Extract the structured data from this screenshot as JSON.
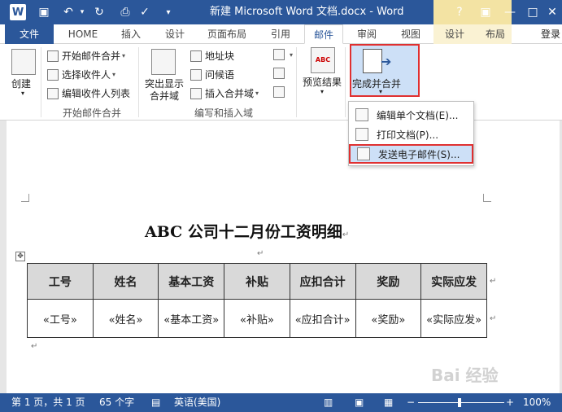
{
  "titlebar": {
    "app_logo": "W",
    "title": "新建 Microsoft Word 文档.docx - Word",
    "help": "?",
    "minimize": "—",
    "restore": "□",
    "close": "✕"
  },
  "tabs": {
    "file": "文件",
    "home": "HOME",
    "insert": "插入",
    "design": "设计",
    "layout": "页面布局",
    "references": "引用",
    "mailings": "邮件",
    "review": "审阅",
    "view": "视图",
    "table_design": "设计",
    "table_layout": "布局",
    "login": "登录"
  },
  "ribbon": {
    "create": "创建",
    "start_mail_merge": "开始邮件合并",
    "select_recipients": "选择收件人",
    "edit_recipient_list": "编辑收件人列表",
    "group_start": "开始邮件合并",
    "highlight_fields_line1": "突出显示",
    "highlight_fields_line2": "合并域",
    "address_block": "地址块",
    "greeting_line": "问候语",
    "insert_merge_field": "插入合并域",
    "group_write": "编写和插入域",
    "preview_results": "预览结果",
    "preview_icon_text": "ABC",
    "finish_merge": "完成并合并"
  },
  "finish_menu": {
    "edit_individual": "编辑单个文档(E)...",
    "print_documents": "打印文档(P)...",
    "send_email": "发送电子邮件(S)..."
  },
  "document": {
    "title": "ABC 公司十二月份工资明细",
    "para_mark": "↵",
    "table_headers": [
      "工号",
      "姓名",
      "基本工资",
      "补贴",
      "应扣合计",
      "奖励",
      "实际应发"
    ],
    "table_row": [
      "«工号»",
      "«姓名»",
      "«基本工资»",
      "«补贴»",
      "«应扣合计»",
      "«奖励»",
      "«实际应发»"
    ]
  },
  "statusbar": {
    "page": "第 1 页，共 1 页",
    "words": "65 个字",
    "language": "英语(美国)",
    "zoom": "100%",
    "zoom_level": 100
  },
  "watermark": "Bai 经验"
}
